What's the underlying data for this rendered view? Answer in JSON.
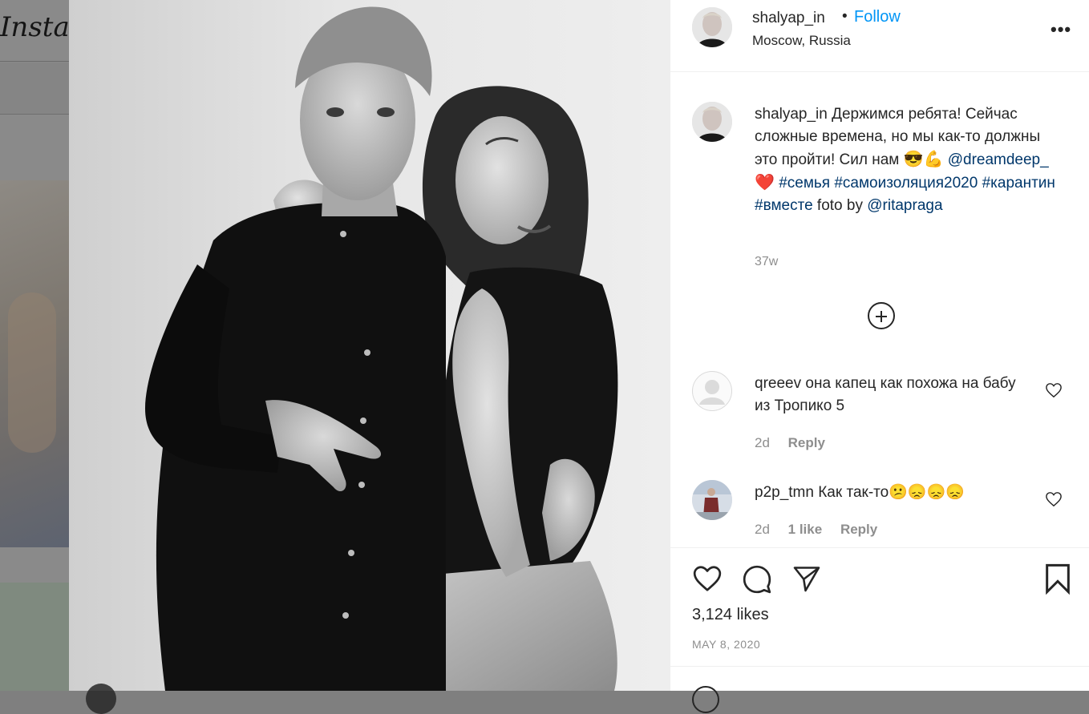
{
  "background_page": {
    "logo": "Instagram"
  },
  "post": {
    "author": {
      "username": "shalyap_in",
      "follow_label": "Follow",
      "separator": "•",
      "location": "Moscow, Russia"
    },
    "more_label": "•••",
    "caption": {
      "username": "shalyap_in",
      "text_1": "Держимся ребята! Сейчас сложные времена, но мы как-то должны это пройти! Сил нам",
      "emoji_1": "😎💪",
      "mention_1": "@dreamdeep_",
      "emoji_heart": "❤️",
      "tag_1": "#семья",
      "tag_2": "#самоизоляция2020",
      "tag_3": "#карантин",
      "tag_4": "#вместе",
      "text_2": "foto by",
      "mention_2": "@ritapraga"
    },
    "caption_time": "37w",
    "comments": [
      {
        "username": "qreeev",
        "text": "она капец как похожа на бабу из Тропико 5",
        "time": "2d",
        "reply_label": "Reply"
      },
      {
        "username": "p2p_tmn",
        "text": "Как так-то😕😞😞😞",
        "time": "2d",
        "likes_label": "1 like",
        "reply_label": "Reply"
      }
    ],
    "likes": "3,124 likes",
    "date": "MAY 8, 2020"
  }
}
